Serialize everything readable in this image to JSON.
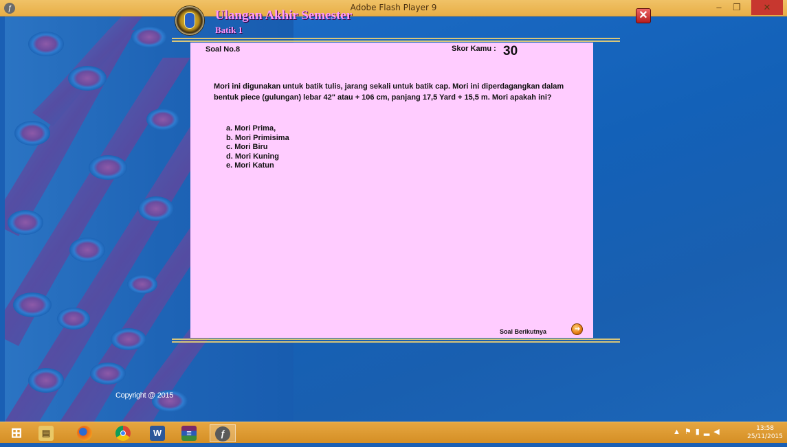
{
  "window": {
    "title": "Adobe Flash Player 9"
  },
  "header": {
    "title": "Ulangan Akhir Semester",
    "subtitle": "Batik 1"
  },
  "quiz": {
    "question_number": "Soal No.8",
    "score_label": "Skor Kamu :",
    "score_value": "30",
    "question": "Mori ini digunakan untuk batik tulis, jarang sekali untuk batik cap. Mori ini diperdagangkan dalam bentuk piece (gulungan) lebar 42\" atau + 106 cm, panjang 17,5 Yard + 15,5 m. Mori apakah ini?",
    "options": [
      "a. Mori Prima,",
      "b. Mori Primisima",
      "c. Mori Biru",
      "d. Mori Kuning",
      "e. Mori Katun"
    ],
    "next_label": "Soal Berikutnya"
  },
  "footer": {
    "copyright": "Copyright @ 2015"
  },
  "taskbar": {
    "items": [
      "start-icon",
      "file-explorer-icon",
      "firefox-icon",
      "chrome-icon",
      "word-icon",
      "winrar-icon",
      "flash-player-icon"
    ],
    "clock_time": "13:58",
    "clock_date": "25/11/2015"
  },
  "colors": {
    "title_bar": "#e8ae46",
    "card_background": "#ffccff",
    "header_text": "#ff99ff",
    "background_blue": "#1a5fb4",
    "close_button": "#c7372f"
  }
}
